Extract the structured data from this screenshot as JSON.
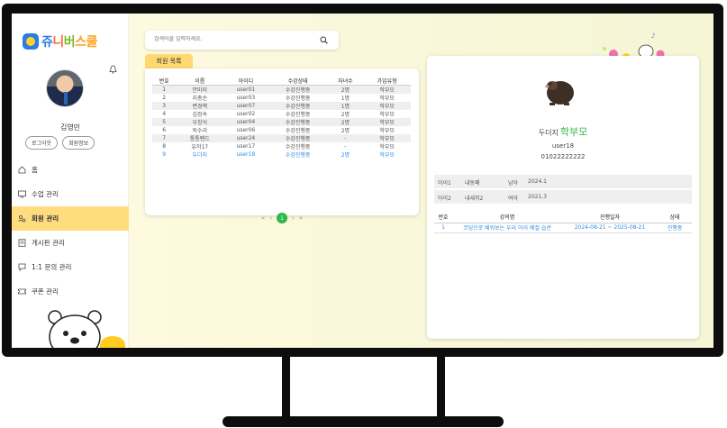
{
  "brand": {
    "logo_parts": [
      "쥬",
      "니",
      "버",
      "스쿨"
    ]
  },
  "user": {
    "name": "김영민",
    "logout_label": "로그아웃",
    "profile_label": "회원정보"
  },
  "nav": [
    {
      "label": "홈",
      "icon": "home-icon"
    },
    {
      "label": "수업 관리",
      "icon": "monitor-icon"
    },
    {
      "label": "회원 관리",
      "icon": "members-icon",
      "active": true
    },
    {
      "label": "게시판 관리",
      "icon": "board-icon"
    },
    {
      "label": "1:1 문의 관리",
      "icon": "chat-icon"
    },
    {
      "label": "쿠폰 관리",
      "icon": "coupon-icon"
    }
  ],
  "search": {
    "placeholder": "검색어를 입력하세요."
  },
  "members": {
    "tab_label": "회원 목록",
    "columns": [
      "번호",
      "이름",
      "아이디",
      "수강상태",
      "자녀수",
      "가입유형"
    ],
    "rows": [
      [
        "1",
        "안마미",
        "user01",
        "수강진행중",
        "2명",
        "학부모"
      ],
      [
        "2",
        "지총순",
        "user03",
        "수강진행중",
        "1명",
        "학부모"
      ],
      [
        "3",
        "변경핵",
        "user07",
        "수강진행중",
        "1명",
        "학부모"
      ],
      [
        "4",
        "김정속",
        "user02",
        "수강진행중",
        "2명",
        "학부모"
      ],
      [
        "5",
        "우창식",
        "user04",
        "수강진행중",
        "2명",
        "학부모"
      ],
      [
        "6",
        "독수리",
        "user06",
        "수강진행중",
        "2명",
        "학부모"
      ],
      [
        "7",
        "통통펜드",
        "user24",
        "수강진행중",
        "-",
        "학부모"
      ],
      [
        "8",
        "유저17",
        "user17",
        "수강진행중",
        "-",
        "학부모"
      ],
      [
        "9",
        "두더지",
        "user18",
        "수강진행중",
        "2명",
        "학부모"
      ]
    ],
    "selected_index": 8,
    "pager": {
      "first": "«",
      "prev": "‹",
      "current": "1",
      "next": "›",
      "last": "»"
    }
  },
  "detail": {
    "name": "두더지",
    "role": "학부모",
    "user_id": "user18",
    "phone": "01022222222",
    "children": [
      {
        "label": "아이1",
        "name": "내동폐",
        "gender": "남아",
        "birth": "2024.1"
      },
      {
        "label": "아이2",
        "name": "내새끼2",
        "gender": "여아",
        "birth": "2021.3"
      }
    ],
    "course_columns": [
      "번호",
      "강의명",
      "진행일자",
      "상태"
    ],
    "courses": [
      {
        "no": "1",
        "title": "코딩으로 배워보는 우리 아이 예절 습관",
        "period": "2024-08-21 ~ 2025-08-21",
        "status": "진행중"
      }
    ]
  }
}
